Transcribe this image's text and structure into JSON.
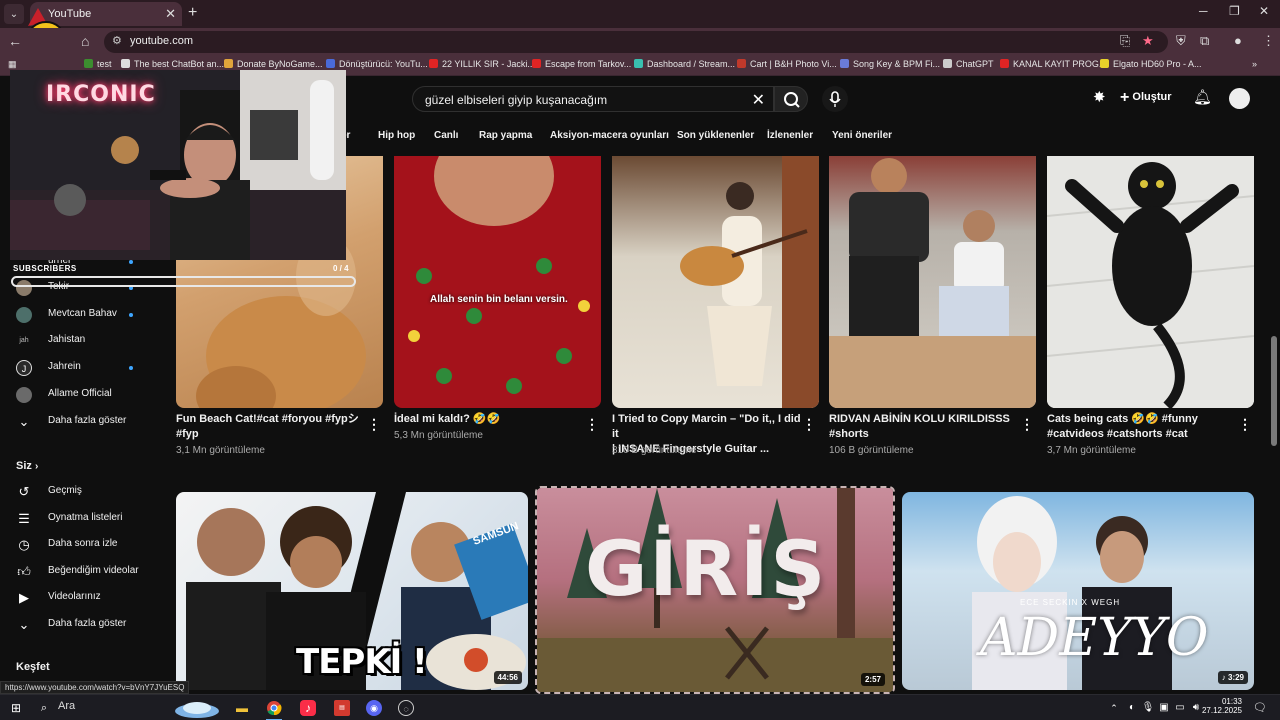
{
  "browser": {
    "tab_title": "YouTube",
    "tab_close": "✕",
    "new_tab": "+",
    "url": "youtube.com",
    "bookmarks": [
      {
        "label": "test",
        "color": "#3c8d2f"
      },
      {
        "label": "The best ChatBot an...",
        "color": "#dddddd"
      },
      {
        "label": "Donate ByNoGame...",
        "color": "#e0a43b"
      },
      {
        "label": "Dönüştürücü: YouTu...",
        "color": "#4a6ad8"
      },
      {
        "label": "22 YILLIK SIR - Jacki...",
        "color": "#e02424"
      },
      {
        "label": "Escape from Tarkov...",
        "color": "#e02424"
      },
      {
        "label": "Dashboard / Stream...",
        "color": "#39c0b0"
      },
      {
        "label": "Cart | B&H Photo Vi...",
        "color": "#c0392b"
      },
      {
        "label": "Song Key & BPM Fi...",
        "color": "#6a7bd8"
      },
      {
        "label": "ChatGPT",
        "color": "#cccccc"
      },
      {
        "label": "KANAL KAYIT PROG...",
        "color": "#e02424"
      },
      {
        "label": "Elgato HD60 Pro - A...",
        "color": "#e8d22a"
      }
    ]
  },
  "header": {
    "search_query": "güzel elbiseleri giyip kuşanacağım",
    "create_label": "Oluştur"
  },
  "chips": [
    "er",
    "Hip hop",
    "Canlı",
    "Rap yapma",
    "Aksiyon-macera oyunları",
    "Son yüklenenler",
    "İzlenenler",
    "Yeni öneriler"
  ],
  "stream_overlay": {
    "neon_text": "IRCONIC",
    "subscribers_label": "SUBSCRIBERS",
    "subscribers_count": "0 / 4"
  },
  "sidebar": {
    "subs_partial": "urner",
    "channels": [
      {
        "label": "Tekir"
      },
      {
        "label": "Mevtcan Bahav"
      },
      {
        "label": "Jahistan"
      },
      {
        "label": "Jahrein"
      },
      {
        "label": "Allame Official"
      }
    ],
    "show_more_1": "Daha fazla göster",
    "you_heading": "Siz",
    "you_items": [
      {
        "label": "Geçmiş",
        "icon": "history-icon"
      },
      {
        "label": "Oynatma listeleri",
        "icon": "playlist-icon"
      },
      {
        "label": "Daha sonra izle",
        "icon": "clock-icon"
      },
      {
        "label": "Beğendiğim videolar",
        "icon": "thumbs-up-icon"
      },
      {
        "label": "Videolarınız",
        "icon": "video-icon"
      }
    ],
    "show_more_2": "Daha fazla göster",
    "explore_heading": "Keşfet"
  },
  "shorts": [
    {
      "title1": "Fun Beach Cat!#cat #foryou #fypシ",
      "title2": "#fyp",
      "views": "3,1 Mn görüntüleme"
    },
    {
      "title1": "İdeal mi kaldı? 🤣🤣",
      "title2": "",
      "views": "5,3 Mn görüntüleme",
      "caption": "Allah senin bin belanı versin."
    },
    {
      "title1": "I Tried to Copy Marcin – \"Do it,, I did it",
      "title2": "| INSANE Fingerstyle Guitar ...",
      "views": "310 B görüntüleme"
    },
    {
      "title1": "RIDVAN ABİNİN KOLU KIRILDISSS",
      "title2": "#shorts",
      "views": "106 B görüntüleme"
    },
    {
      "title1": "Cats being cats 🤣🤣 #funny",
      "title2": "#catvideos #catshorts #cat",
      "views": "3,7 Mn görüntüleme"
    }
  ],
  "videos": [
    {
      "thumb_text": "TEPKİ !",
      "duration": "44:56",
      "sign_text": "SAMSUN"
    },
    {
      "thumb_text": "GİRİŞ",
      "duration": "2:57"
    },
    {
      "thumb_text": "ADEYYO",
      "thumb_sub": "ECE SECKIN X WEGH",
      "duration": "♪ 3:29"
    }
  ],
  "status_url": "https://www.youtube.com/watch?v=bVnY7JYuESQ",
  "taskbar": {
    "search_label": "Ara",
    "time": "01:33",
    "date": "27.12.2025"
  }
}
